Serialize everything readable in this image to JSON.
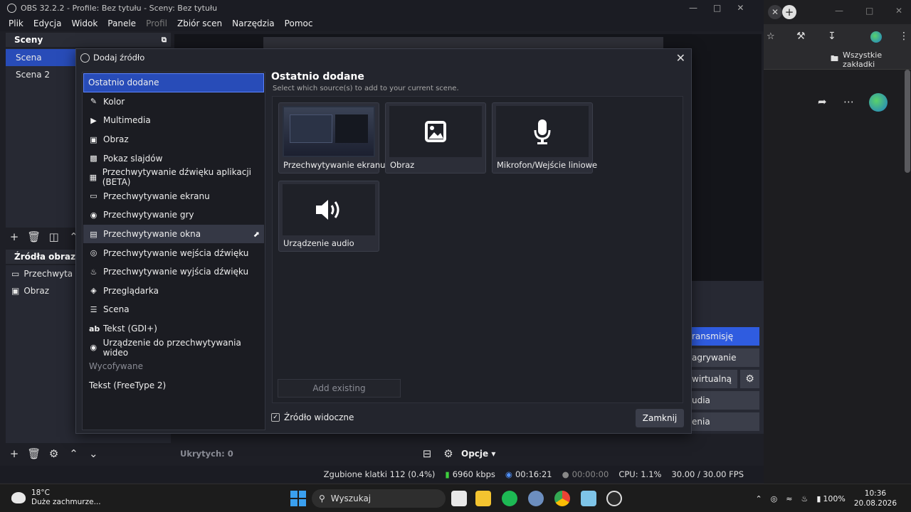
{
  "obs": {
    "title": "OBS 32.2.2 - Profile: Bez tytułu - Sceny: Bez tytułu",
    "menu": [
      "Plik",
      "Edycja",
      "Widok",
      "Panele",
      "Profil",
      "Zbiór scen",
      "Narzędzia",
      "Pomoc"
    ],
    "menu_disabled_index": 4,
    "scenes_header": "Sceny",
    "scenes": [
      "Scena",
      "Scena 2"
    ],
    "sources_header": "Źródła obrazu",
    "sources": [
      "Przechwyta",
      "Obraz"
    ],
    "hidden_count": "Ukrytych: 0",
    "options_label": "Opcje",
    "controls": [
      "ransmisję",
      "agrywanie",
      "wirtualną",
      "udia",
      "enia"
    ],
    "status": {
      "dropped": "Zgubione klatki 112 (0.4%)",
      "bitrate": "6960 kbps",
      "stream_time": "00:16:21",
      "rec_time": "00:00:00",
      "cpu": "CPU: 1.1%",
      "fps": "30.00 / 30.00 FPS"
    }
  },
  "dialog": {
    "title": "Dodaj źródło",
    "list": [
      {
        "label": "Ostatnio dodane",
        "icon": "none",
        "state": "selected"
      },
      {
        "label": "Kolor",
        "icon": "brush-icon"
      },
      {
        "label": "Multimedia",
        "icon": "play-icon"
      },
      {
        "label": "Obraz",
        "icon": "image-icon"
      },
      {
        "label": "Pokaz slajdów",
        "icon": "slideshow-icon"
      },
      {
        "label": "Przechwytywanie dźwięku aplikacji (BETA)",
        "icon": "app-audio-icon"
      },
      {
        "label": "Przechwytywanie ekranu",
        "icon": "monitor-icon"
      },
      {
        "label": "Przechwytywanie gry",
        "icon": "gamepad-icon"
      },
      {
        "label": "Przechwytywanie okna",
        "icon": "window-icon",
        "state": "hover"
      },
      {
        "label": "Przechwytywanie wejścia dźwięku",
        "icon": "microphone-icon"
      },
      {
        "label": "Przechwytywanie wyjścia dźwięku",
        "icon": "speaker-icon"
      },
      {
        "label": "Przeglądarka",
        "icon": "globe-icon"
      },
      {
        "label": "Scena",
        "icon": "list-icon"
      },
      {
        "label": "Tekst (GDI+)",
        "icon": "text-icon"
      },
      {
        "label": "Urządzenie do przechwytywania wideo",
        "icon": "camera-icon"
      },
      {
        "label": "Wycofywane",
        "icon": "none",
        "state": "header"
      },
      {
        "label": "Tekst (FreeType 2)",
        "icon": "none"
      }
    ],
    "section_title": "Ostatnio dodane",
    "section_subtitle": "Select which source(s) to add to your current scene.",
    "tiles": [
      {
        "label": "Przechwytywanie ekranu",
        "icon": "screenshot-thumbnail"
      },
      {
        "label": "Obraz",
        "icon": "image-icon"
      },
      {
        "label": "Mikrofon/Wejście liniowe",
        "icon": "microphone-icon"
      },
      {
        "label": "Urządzenie audio",
        "icon": "speaker-icon"
      }
    ],
    "add_existing": "Add existing",
    "visible_label": "Źródło widoczne",
    "visible_checked": true,
    "close_button": "Zamknij"
  },
  "browser": {
    "bookmarks_label": "Wszystkie zakładki"
  },
  "taskbar": {
    "weather_temp": "18°C",
    "weather_desc": "Duże zachmurze...",
    "search_placeholder": "Wyszukaj",
    "battery": "100%",
    "time": "10:36",
    "date": "20.08.2026"
  },
  "colors": {
    "accent": "#284cb8",
    "active_button": "#2f5ce0",
    "status_green": "#3ecf3e",
    "status_blue": "#4f8ff7"
  }
}
